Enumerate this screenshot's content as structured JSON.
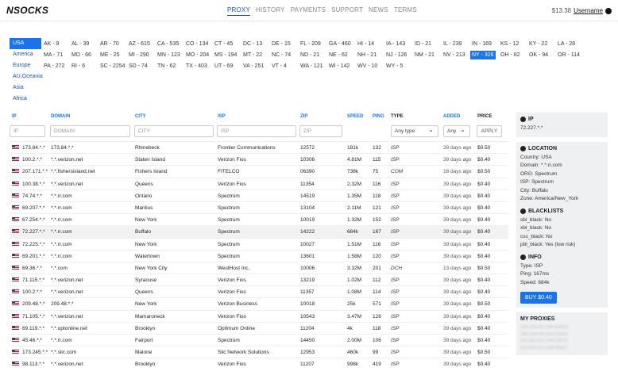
{
  "header": {
    "logo": "NSOCKS",
    "nav": [
      "PROXY",
      "HISTORY",
      "PAYMENTS",
      "SUPPORT",
      "NEWS",
      "TERMS"
    ],
    "active_nav": "PROXY",
    "balance": "$13.38",
    "username": "Username"
  },
  "regions": [
    "USA",
    "America",
    "Europe",
    "AU,Oceania",
    "Asia",
    "Africa"
  ],
  "selected_region": "USA",
  "states": [
    [
      "AK - 9",
      "AL - 39",
      "AR - 70",
      "AZ - 615",
      "CA - 535",
      "CO - 134",
      "CT - 45",
      "DC - 13",
      "DE - 15",
      "FL - 209",
      "GA - 460",
      "HI - 14",
      "IA - 143",
      "ID - 21",
      "IL - 239",
      "IN - 169",
      "KS - 12",
      "KY - 22",
      "LA - 28"
    ],
    [
      "MA - 71",
      "MD - 66",
      "ME - 25",
      "MI - 290",
      "MN - 123",
      "MO - 204",
      "MS - 194",
      "MT - 22",
      "NC - 74",
      "ND - 21",
      "NE - 62",
      "NH - 21",
      "NJ - 126",
      "NM - 21",
      "NV - 213",
      "NY - 326",
      "OH - 82",
      "OK - 94",
      "OR - 114"
    ],
    [
      "PA - 272",
      "RI - 6",
      "SC - 2254",
      "SD - 74",
      "TN - 62",
      "TX - 403",
      "UT - 69",
      "VA - 251",
      "VT - 4",
      "WA - 121",
      "WI - 142",
      "WV - 10",
      "WY - 5"
    ]
  ],
  "selected_state": "NY - 326",
  "table": {
    "columns": [
      "IP",
      "DOMAIN",
      "CITY",
      "ISP",
      "ZIP",
      "SPEED",
      "PING",
      "TYPE",
      "ADDED",
      "PRICE"
    ],
    "filters": {
      "ip": "IP",
      "domain": "DOMAIN",
      "city": "CITY",
      "isp": "ISP",
      "zip": "ZIP",
      "type": "Any type",
      "added": "Any",
      "apply": "APPLY"
    },
    "rows": [
      [
        "173.84.*.*",
        "173.84.*.*",
        "Rhinebeck",
        "Frontier Communications",
        "12572",
        "181k",
        "132",
        "ISP",
        "39 days ago",
        "$0.50"
      ],
      [
        "100.2.*.*",
        "*.*.verizon.net",
        "Staten Island",
        "Verizon Fios",
        "10306",
        "4.81M",
        "115",
        "ISP",
        "39 days ago",
        "$0.40"
      ],
      [
        "207.171.*.*",
        "*.*.fishersisland.net",
        "Fishers Island",
        "FITELCO",
        "06390",
        "738k",
        "75",
        "COM",
        "18 days ago",
        "$0.50"
      ],
      [
        "100.38.*.*",
        "*.*.verizon.net",
        "Queens",
        "Verizon Fios",
        "11354",
        "2.32M",
        "116",
        "ISP",
        "39 days ago",
        "$0.40"
      ],
      [
        "74.74.*.*",
        "*.*.rr.com",
        "Ontario",
        "Spectrum",
        "14519",
        "1.35M",
        "118",
        "ISP",
        "39 days ago",
        "$0.40"
      ],
      [
        "69.207.*.*",
        "*.*.rr.com",
        "Manlius",
        "Spectrum",
        "13104",
        "2.11M",
        "121",
        "ISP",
        "39 days ago",
        "$0.40"
      ],
      [
        "67.254.*.*",
        "*.*.rr.com",
        "New York",
        "Spectrum",
        "10019",
        "1.32M",
        "152",
        "ISP",
        "39 days ago",
        "$0.40"
      ],
      [
        "72.227.*.*",
        "*.*.rr.com",
        "Buffalo",
        "Spectrum",
        "14222",
        "684k",
        "167",
        "ISP",
        "39 days ago",
        "$0.40"
      ],
      [
        "72.225.*.*",
        "*.*.rr.com",
        "New York",
        "Spectrum",
        "10027",
        "1.51M",
        "116",
        "ISP",
        "39 days ago",
        "$0.40"
      ],
      [
        "69.201.*.*",
        "*.*.rr.com",
        "Watertown",
        "Spectrum",
        "13601",
        "1.58M",
        "120",
        "ISP",
        "39 days ago",
        "$0.40"
      ],
      [
        "69.36.*.*",
        "*.*.com",
        "New York City",
        "WestHost Inc.",
        "10006",
        "3.32M",
        "201",
        "DCH",
        "13 days ago",
        "$0.50"
      ],
      [
        "71.115.*.*",
        "*.*.verizon.net",
        "Syracuse",
        "Verizon Fios",
        "13219",
        "1.02M",
        "112",
        "ISP",
        "39 days ago",
        "$0.40"
      ],
      [
        "100.2.*.*",
        "*.*.verizon.net",
        "Queens",
        "Verizon Fios",
        "11357",
        "1.08M",
        "114",
        "ISP",
        "39 days ago",
        "$0.40"
      ],
      [
        "209.48.*.*",
        "209.48.*.*",
        "New York",
        "Verizon Business",
        "10018",
        "25k",
        "571",
        "ISP",
        "39 days ago",
        "$0.50"
      ],
      [
        "71.105.*.*",
        "*.*.verizon.net",
        "Mamaroneck",
        "Verizon Fios",
        "10543",
        "3.47M",
        "128",
        "ISP",
        "39 days ago",
        "$0.40"
      ],
      [
        "69.119.*.*",
        "*.*.optonline.net",
        "Brooklyn",
        "Optimum Online",
        "11204",
        "4k",
        "118",
        "ISP",
        "39 days ago",
        "$0.40"
      ],
      [
        "45.46.*.*",
        "*.*.rr.com",
        "Fairport",
        "Spectrum",
        "14450",
        "2.00M",
        "106",
        "ISP",
        "39 days ago",
        "$0.40"
      ],
      [
        "173.245.*.*",
        "*.*.slic.com",
        "Malone",
        "Slic Network Solutions",
        "12953",
        "460k",
        "99",
        "ISP",
        "39 days ago",
        "$0.50"
      ],
      [
        "98.113.*.*",
        "*.*.verizon.net",
        "Brooklyn",
        "Verizon Fios",
        "11207",
        "998k",
        "419",
        "ISP",
        "39 days ago",
        "$0.40"
      ]
    ]
  },
  "side": {
    "ip_title": "IP",
    "ip_value": "72.227.*.*",
    "location_title": "LOCATION",
    "location": [
      "Country: USA",
      "Domain: *.*.rr.com",
      "ORG: Spectrum",
      "ISP: Spectrum",
      "City: Buffalo",
      "Zone: America/New_York"
    ],
    "blacklists_title": "BLACKLISTS",
    "blacklists": [
      "sbl_black: No",
      "xbl_black: No",
      "css_black: No",
      "pbl_black: Yes (low risk)"
    ],
    "info_title": "INFO",
    "info": [
      "Type: ISP",
      "Ping: 167ms",
      "Speed: 684k"
    ],
    "buy_label": "BUY $0.40",
    "myproxies_title": "MY PROXIES",
    "myproxies": [
      "195.154.40.184:42415",
      "195.154.40.192:33342",
      "212.83.137.159:22075",
      "212.83.137.159:39827"
    ]
  }
}
